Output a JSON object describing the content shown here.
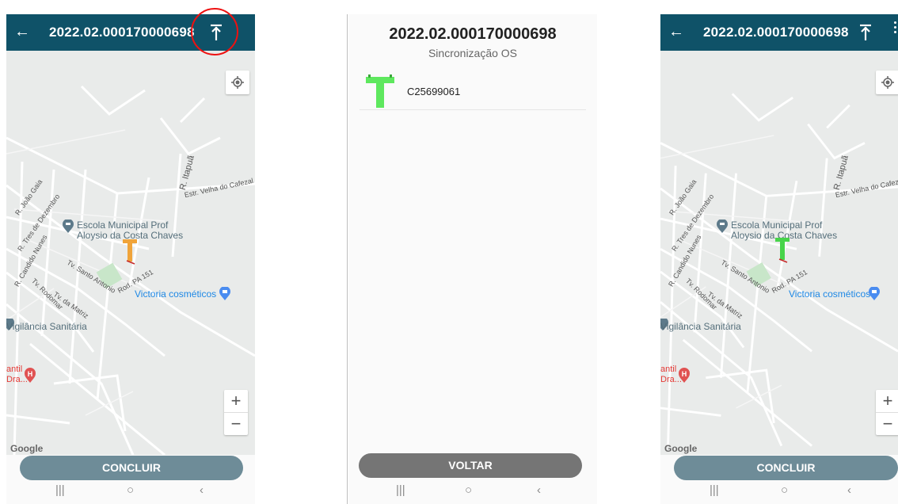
{
  "screens": {
    "left": {
      "title": "2022.02.000170000698",
      "button": "CONCLUIR",
      "pole_color": "#f0a43a"
    },
    "middle": {
      "title": "2022.02.000170000698",
      "subtitle": "Sincronização OS",
      "items": [
        {
          "label": "C25699061",
          "icon": "utility-pole-icon"
        }
      ],
      "button": "VOLTAR"
    },
    "right": {
      "title": "2022.02.000170000698",
      "button": "CONCLUIR",
      "pole_color": "#47d44a"
    }
  },
  "map": {
    "poi_school": "Escola Municipal Prof",
    "poi_school_2a": "Aloysio da ",
    "poi_school_2b": "Costa",
    "poi_school_2c": " Chaves",
    "poi_store": "Victoria cosméticos",
    "poi_health": "Vigilância Sanitária",
    "poi_hospital_1": "antil",
    "poi_hospital_2": "Dra...",
    "streets": {
      "itapua": "R. Itapuã",
      "cafezal": "Estr. Velha do Cafezal",
      "joao_gaia": "R. João Gaia",
      "tres_dezembro": "R. Tres de Dezembro",
      "candido": "R. Candido Nunes",
      "santo_antonio": "Tv. Santo Antonio",
      "rod": "Rod. PA 151",
      "rodomar": "Tv. Rodomar",
      "matriz": "Tv. da Matriz"
    },
    "attribution": "Google"
  },
  "icons": {
    "back": "back-arrow-icon",
    "sync": "sync-upload-icon",
    "more": "more-vert-icon",
    "location": "my-location-icon"
  },
  "colors": {
    "appbar": "#0f5268",
    "concluir": "#6e8c98",
    "voltar": "#757575",
    "highlight": "#e11111"
  }
}
